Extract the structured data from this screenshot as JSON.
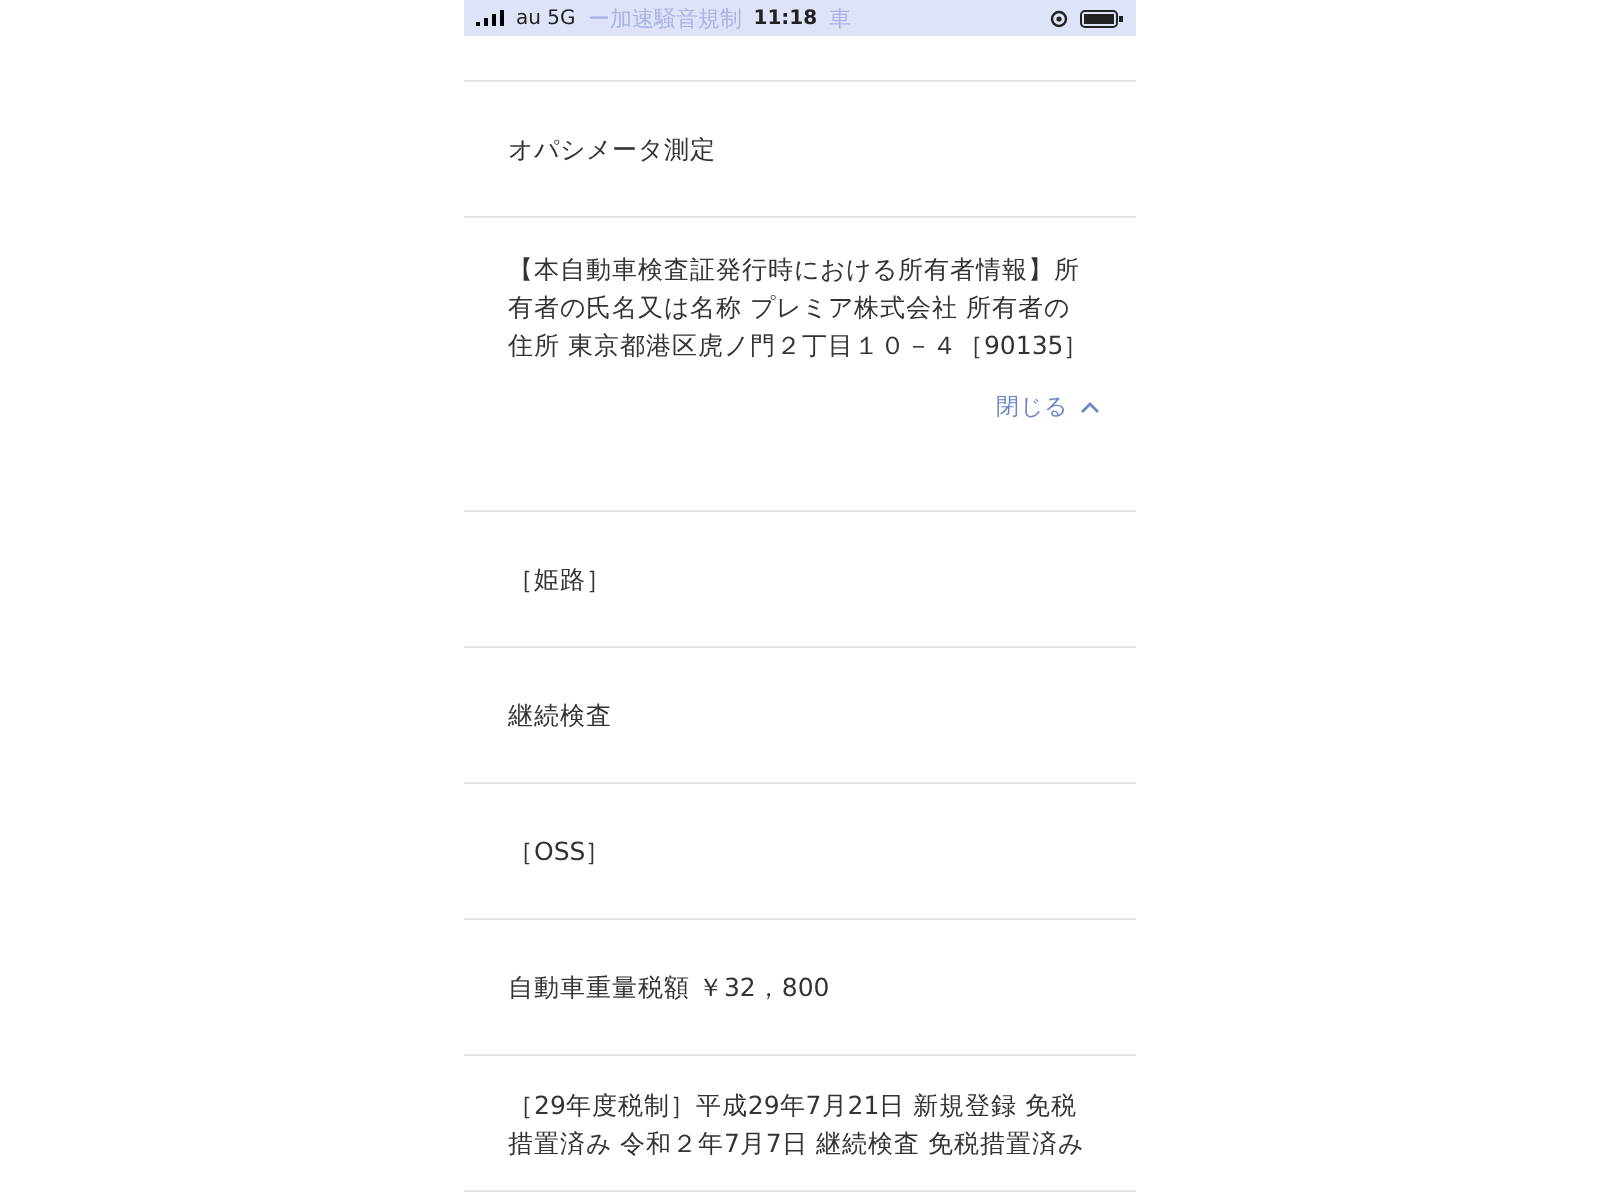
{
  "status_bar": {
    "carrier": "au 5G",
    "title_left": "ー加速騒音規制",
    "time": "11:18",
    "title_right": "車"
  },
  "rows": [
    {
      "kind": "blank"
    },
    {
      "kind": "text",
      "text": "オパシメータ測定"
    },
    {
      "kind": "expanded",
      "text": "【本自動車検査証発行時における所有者情報】所有者の氏名又は名称 プレミア株式会社 所有者の住所 東京都港区虎ノ門２丁目１０－４［90135］",
      "toggle": "閉じる"
    },
    {
      "kind": "text",
      "text": "［姫路］"
    },
    {
      "kind": "text",
      "text": "継続検査"
    },
    {
      "kind": "text",
      "text": "［OSS］"
    },
    {
      "kind": "text",
      "text": "自動車重量税額 ￥32，800"
    },
    {
      "kind": "text",
      "text": "［29年度税制］平成29年7月21日 新規登録 免税措置済み 令和２年7月7日 継続検査 免税措置済み"
    }
  ]
}
